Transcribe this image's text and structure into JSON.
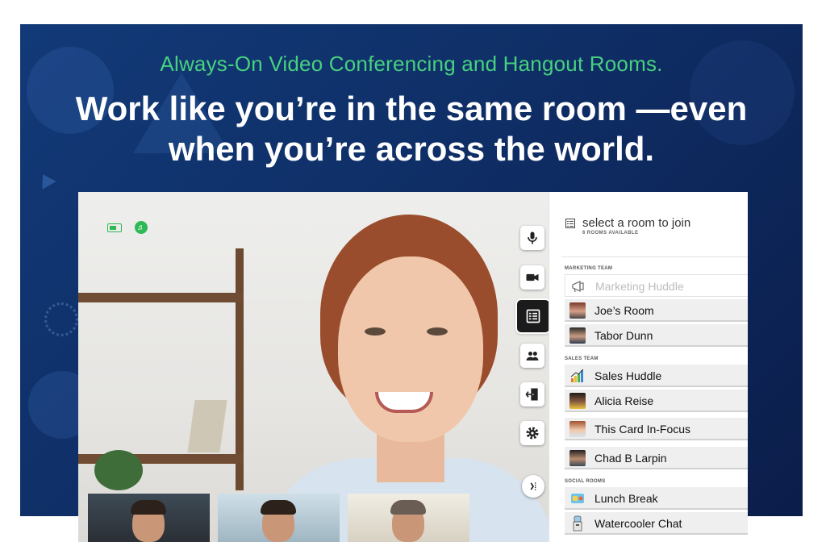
{
  "hero": {
    "tagline": "Always-On Video Conferencing and Hangout Rooms.",
    "headline_line1": "Work like you’re in the same room —even",
    "headline_line2": "when you’re across the world."
  },
  "colors": {
    "accent_green": "#47d17f",
    "hero_background": "#0f2e66",
    "active_control": "#1b1b1b"
  },
  "video": {
    "status_icons": [
      "battery-icon",
      "speaker-icon"
    ],
    "controls": [
      {
        "name": "microphone",
        "icon": "microphone-icon",
        "active": false
      },
      {
        "name": "camera",
        "icon": "camera-icon",
        "active": false
      },
      {
        "name": "room-list",
        "icon": "list-icon",
        "active": true
      },
      {
        "name": "participants",
        "icon": "people-icon",
        "active": false
      },
      {
        "name": "leave",
        "icon": "exit-door-icon",
        "active": false
      },
      {
        "name": "settings",
        "icon": "gear-icon",
        "active": false
      }
    ],
    "thumbnails": [
      "participant-1",
      "participant-2",
      "participant-3"
    ]
  },
  "panel": {
    "title": "select a room to join",
    "subtitle": "6 ROOMS AVAILABLE",
    "sections": [
      {
        "label": "MARKETING TEAM",
        "rooms": [
          {
            "label": "Marketing Huddle",
            "icon": "megaphone-icon",
            "dimmed": true
          },
          {
            "label": "Joe’s Room",
            "icon": "avatar",
            "dimmed": false
          },
          {
            "label": "Tabor Dunn",
            "icon": "avatar",
            "dimmed": false
          }
        ]
      },
      {
        "label": "SALES TEAM",
        "rooms": [
          {
            "label": "Sales Huddle",
            "icon": "bar-chart-icon",
            "dimmed": false
          },
          {
            "label": "Alicia Reise",
            "icon": "avatar",
            "dimmed": false
          },
          {
            "label": "This Card In-Focus",
            "icon": "avatar",
            "dimmed": false
          },
          {
            "label": "Chad B Larpin",
            "icon": "avatar",
            "dimmed": false
          }
        ]
      },
      {
        "label": "SOCIAL ROOMS",
        "rooms": [
          {
            "label": "Lunch Break",
            "icon": "lunch-icon",
            "dimmed": false
          },
          {
            "label": "Watercooler Chat",
            "icon": "watercooler-icon",
            "dimmed": false
          }
        ]
      }
    ]
  }
}
